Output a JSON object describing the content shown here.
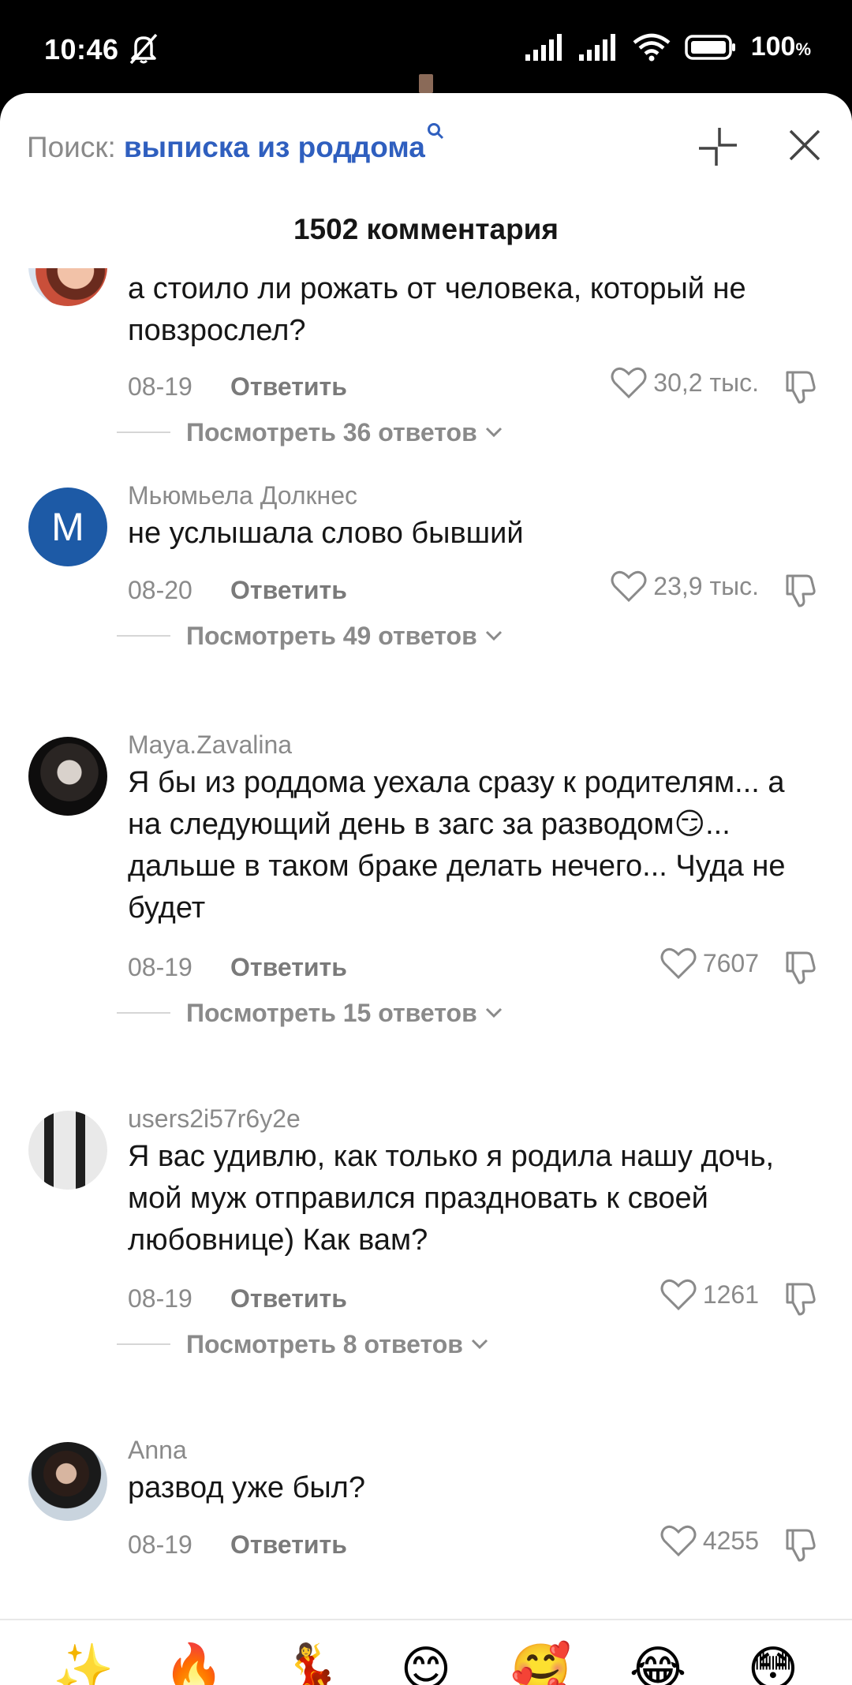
{
  "status_bar": {
    "time": "10:46",
    "battery": "100",
    "battery_unit": "%"
  },
  "search": {
    "label": "Поиск:",
    "query": "выписка из роддома"
  },
  "header": {
    "comments_count": "1502 комментария"
  },
  "comments": [
    {
      "author": "",
      "text": "а стоило ли рожать от человека, который не повзрослел?",
      "date": "08-19",
      "reply_label": "Ответить",
      "likes": "30,2 тыс.",
      "view_replies": "Посмотреть 36 ответов",
      "avatar": "photo-avatar"
    },
    {
      "author": "Мьюмьела Долкнес",
      "text": "не услышала слово бывший",
      "date": "08-20",
      "reply_label": "Ответить",
      "likes": "23,9 тыс.",
      "view_replies": "Посмотреть 49 ответов",
      "avatar_letter": "M"
    },
    {
      "author": "Maya.Zavalina",
      "text": "Я бы из роддома уехала сразу к родителям... а на следующий день в загс за разводом😏... дальше в таком браке делать нечего... Чуда не будет",
      "date": "08-19",
      "reply_label": "Ответить",
      "likes": "7607",
      "view_replies": "Посмотреть 15 ответов",
      "avatar": "photo-avatar"
    },
    {
      "author": "users2i57r6y2e",
      "text": "Я вас удивлю, как только я родила нашу дочь, мой муж отправился праздновать к своей любовнице) Как вам?",
      "date": "08-19",
      "reply_label": "Ответить",
      "likes": "1261",
      "view_replies": "Посмотреть 8 ответов",
      "avatar": "photo-avatar"
    },
    {
      "author": "Anna",
      "text": "развод уже был?",
      "date": "08-19",
      "reply_label": "Ответить",
      "likes": "4255",
      "avatar": "photo-avatar"
    }
  ],
  "emoji_bar": [
    "✨",
    "🔥",
    "💃",
    "😊",
    "🥰",
    "😂",
    "😳"
  ],
  "colors": {
    "accent_query": "#2f5fbf",
    "muted_text": "#8a8a8a",
    "avatar_blue": "#1d5aa6"
  }
}
